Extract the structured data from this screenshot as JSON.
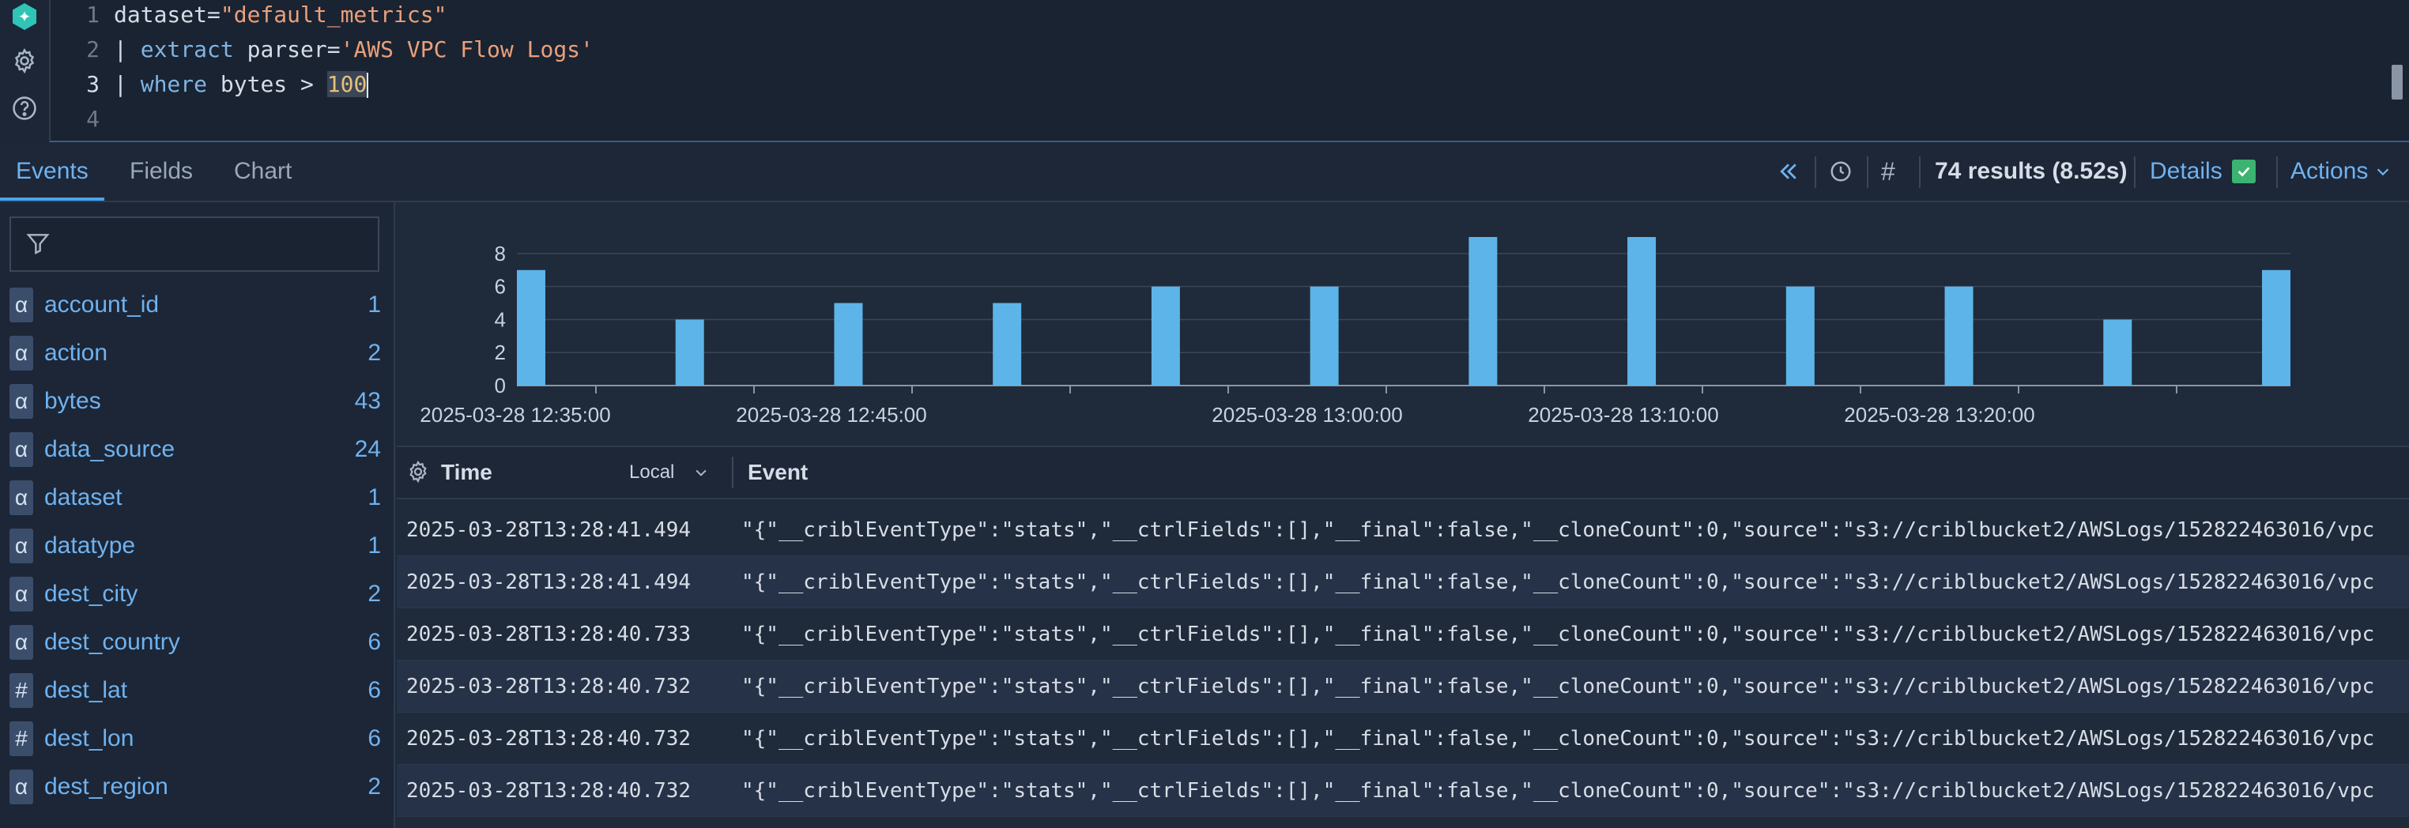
{
  "editor": {
    "lines": [
      {
        "num": "1"
      },
      {
        "num": "2"
      },
      {
        "num": "3"
      },
      {
        "num": "4"
      }
    ],
    "line1": {
      "key": "dataset=",
      "value": "\"default_metrics\""
    },
    "line2": {
      "pipe": "| ",
      "cmd": "extract",
      "arg": " parser=",
      "value": "'AWS VPC Flow Logs'"
    },
    "line3": {
      "pipe": "| ",
      "cmd": "where",
      "arg": " bytes > ",
      "value": "100"
    }
  },
  "tabs": [
    {
      "label": "Events"
    },
    {
      "label": "Fields"
    },
    {
      "label": "Chart"
    }
  ],
  "toolbar": {
    "results": "74 results (8.52s)",
    "details_label": "Details",
    "actions_label": "Actions"
  },
  "sidebar": {
    "filter_placeholder": "",
    "fields": [
      {
        "type": "α",
        "name": "account_id",
        "count": "1"
      },
      {
        "type": "α",
        "name": "action",
        "count": "2"
      },
      {
        "type": "α",
        "name": "bytes",
        "count": "43"
      },
      {
        "type": "α",
        "name": "data_source",
        "count": "24"
      },
      {
        "type": "α",
        "name": "dataset",
        "count": "1"
      },
      {
        "type": "α",
        "name": "datatype",
        "count": "1"
      },
      {
        "type": "α",
        "name": "dest_city",
        "count": "2"
      },
      {
        "type": "α",
        "name": "dest_country",
        "count": "6"
      },
      {
        "type": "#",
        "name": "dest_lat",
        "count": "6"
      },
      {
        "type": "#",
        "name": "dest_lon",
        "count": "6"
      },
      {
        "type": "α",
        "name": "dest_region",
        "count": "2"
      }
    ]
  },
  "chart_data": {
    "type": "bar",
    "values": [
      7,
      4,
      5,
      5,
      6,
      6,
      9,
      9,
      6,
      6,
      4,
      7
    ],
    "ylim": [
      0,
      8
    ],
    "yticks": [
      "0",
      "2",
      "4",
      "6",
      "8"
    ],
    "xticks": [
      "2025-03-28 12:35:00",
      "2025-03-28 12:45:00",
      "2025-03-28 13:00:00",
      "2025-03-28 13:10:00",
      "2025-03-28 13:20:00"
    ],
    "color": "#5db4e8"
  },
  "table": {
    "time_header": "Time",
    "tz_label": "Local",
    "event_header": "Event",
    "rows": [
      {
        "time": "2025-03-28T13:28:41.494",
        "event": "\"{\"__criblEventType\":\"stats\",\"__ctrlFields\":[],\"__final\":false,\"__cloneCount\":0,\"source\":\"s3://criblbucket2/AWSLogs/152822463016/vpc"
      },
      {
        "time": "2025-03-28T13:28:41.494",
        "event": "\"{\"__criblEventType\":\"stats\",\"__ctrlFields\":[],\"__final\":false,\"__cloneCount\":0,\"source\":\"s3://criblbucket2/AWSLogs/152822463016/vpc"
      },
      {
        "time": "2025-03-28T13:28:40.733",
        "event": "\"{\"__criblEventType\":\"stats\",\"__ctrlFields\":[],\"__final\":false,\"__cloneCount\":0,\"source\":\"s3://criblbucket2/AWSLogs/152822463016/vpc"
      },
      {
        "time": "2025-03-28T13:28:40.732",
        "event": "\"{\"__criblEventType\":\"stats\",\"__ctrlFields\":[],\"__final\":false,\"__cloneCount\":0,\"source\":\"s3://criblbucket2/AWSLogs/152822463016/vpc"
      },
      {
        "time": "2025-03-28T13:28:40.732",
        "event": "\"{\"__criblEventType\":\"stats\",\"__ctrlFields\":[],\"__final\":false,\"__cloneCount\":0,\"source\":\"s3://criblbucket2/AWSLogs/152822463016/vpc"
      },
      {
        "time": "2025-03-28T13:28:40.732",
        "event": "\"{\"__criblEventType\":\"stats\",\"__ctrlFields\":[],\"__final\":false,\"__cloneCount\":0,\"source\":\"s3://criblbucket2/AWSLogs/152822463016/vpc"
      }
    ]
  }
}
